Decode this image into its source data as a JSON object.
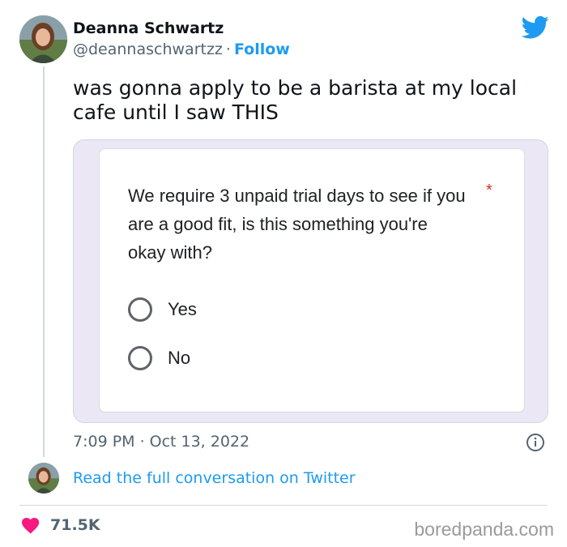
{
  "tweet": {
    "author": {
      "display_name": "Deanna Schwartz",
      "handle": "@deannaschwartzz",
      "separator": "·",
      "follow_label": "Follow"
    },
    "text": "was gonna apply to be a barista at my local cafe until I saw THIS",
    "media": {
      "form": {
        "question": "We require 3 unpaid trial days to see if you are a good fit, is this something you're okay with?",
        "required_marker": "*",
        "options": [
          "Yes",
          "No"
        ]
      }
    },
    "time": "7:09 PM",
    "date_separator": "·",
    "date": "Oct 13, 2022",
    "read_conversation_label": "Read the full conversation on Twitter",
    "likes": "71.5K"
  },
  "watermark": "boredpanda.com",
  "colors": {
    "twitter_blue": "#1d9bf0",
    "like_pink": "#f91880",
    "required_red": "#d93025",
    "media_background": "#ebe7f5"
  },
  "icons": [
    "twitter-bird-icon",
    "info-icon",
    "heart-icon"
  ]
}
